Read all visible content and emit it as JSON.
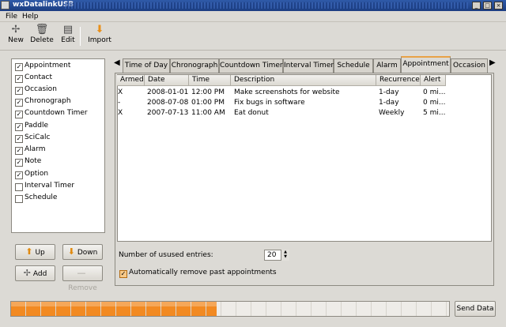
{
  "window": {
    "title": "wxDatalinkUSB"
  },
  "menu": [
    "File",
    "Help"
  ],
  "toolbar": [
    {
      "label": "New",
      "icon": "new-icon"
    },
    {
      "label": "Delete",
      "icon": "delete-icon"
    },
    {
      "label": "Edit",
      "icon": "edit-icon"
    },
    {
      "label": "Import",
      "icon": "import-icon"
    }
  ],
  "applications": [
    {
      "label": "Appointment",
      "checked": true
    },
    {
      "label": "Contact",
      "checked": true
    },
    {
      "label": "Occasion",
      "checked": true
    },
    {
      "label": "Chronograph",
      "checked": true
    },
    {
      "label": "Countdown Timer",
      "checked": true
    },
    {
      "label": "Paddle",
      "checked": true
    },
    {
      "label": "SciCalc",
      "checked": true
    },
    {
      "label": "Alarm",
      "checked": true
    },
    {
      "label": "Note",
      "checked": true
    },
    {
      "label": "Option",
      "checked": true
    },
    {
      "label": "Interval Timer",
      "checked": false
    },
    {
      "label": "Schedule",
      "checked": false
    }
  ],
  "buttons": {
    "up": "Up",
    "down": "Down",
    "add": "Add",
    "remove": "Remove"
  },
  "tabs": [
    "Time of Day",
    "Chronograph",
    "Countdown Timer",
    "Interval Timer",
    "Schedule",
    "Alarm",
    "Appointment",
    "Occasion"
  ],
  "active_tab": "Appointment",
  "table": {
    "columns": [
      "Armed",
      "Date",
      "Time",
      "Description",
      "Recurrence",
      "Alert"
    ],
    "rows": [
      [
        "X",
        "2008-01-01",
        "12:00 PM",
        "Make screenshots for website",
        "1-day",
        "0 mi..."
      ],
      [
        "-",
        "2008-07-08",
        "01:00 PM",
        "Fix bugs in software",
        "1-day",
        "0 mi..."
      ],
      [
        "X",
        "2007-07-13",
        "11:00 AM",
        "Eat donut",
        "Weekly",
        "5 mi..."
      ]
    ]
  },
  "used_entries": {
    "label": "Number of usused entries:",
    "value": "20"
  },
  "auto_remove": {
    "label": "Automatically remove past appointments",
    "checked": true
  },
  "progress": {
    "fraction": 0.47
  },
  "send_button": "Send Data",
  "colors": {
    "accent": "#e8a248",
    "progress": "#f28a22",
    "titlebar": "#1b3c80"
  }
}
